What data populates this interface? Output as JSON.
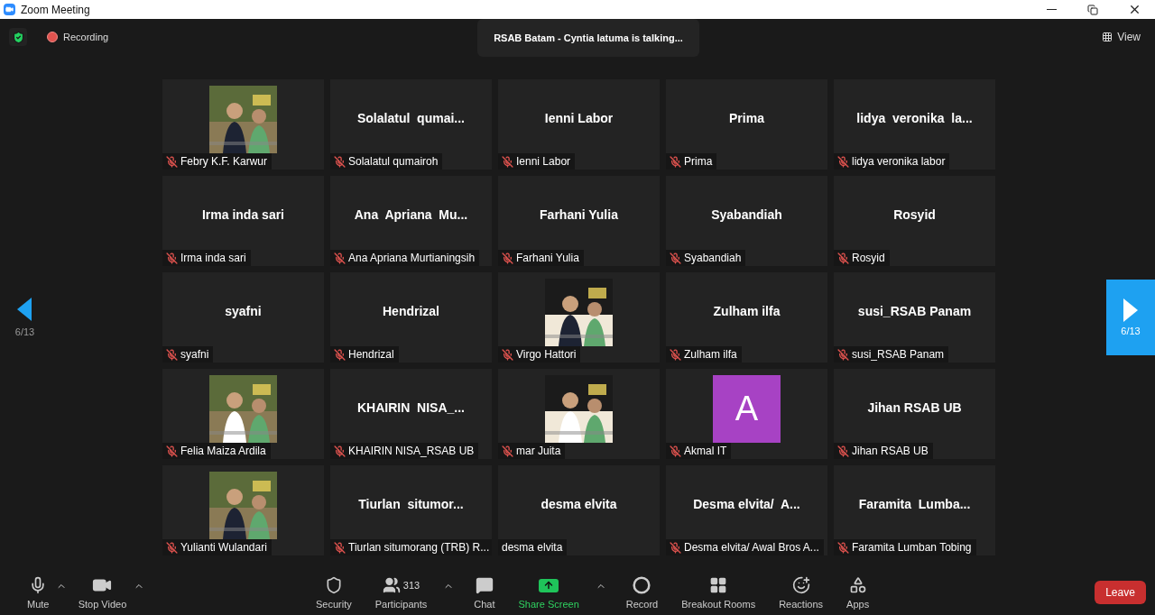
{
  "window": {
    "title": "Zoom Meeting"
  },
  "top_bar": {
    "recording": "Recording",
    "talking": "RSAB Batam - Cyntia latuma is talking...",
    "view": "View"
  },
  "pager": {
    "previous": "6/13",
    "next": "6/13"
  },
  "participants": [
    {
      "kind": "picture",
      "label": "Febry K.F. Karwur",
      "muted": true
    },
    {
      "kind": "name",
      "display_name": "Solalatul  qumai...",
      "label": "Solalatul qumairoh",
      "muted": true
    },
    {
      "kind": "name",
      "display_name": "Ienni Labor",
      "label": "Ienni Labor",
      "muted": true
    },
    {
      "kind": "name",
      "display_name": "Prima",
      "label": "Prima",
      "muted": true
    },
    {
      "kind": "name",
      "display_name": "lidya  veronika  la...",
      "label": "lidya veronika labor",
      "muted": true
    },
    {
      "kind": "name",
      "display_name": "Irma inda sari",
      "label": "Irma inda sari",
      "muted": true
    },
    {
      "kind": "name",
      "display_name": "Ana  Apriana  Mu...",
      "label": "Ana Apriana Murtianingsih",
      "muted": true
    },
    {
      "kind": "name",
      "display_name": "Farhani Yulia",
      "label": "Farhani Yulia",
      "muted": true
    },
    {
      "kind": "name",
      "display_name": "Syabandiah",
      "label": "Syabandiah",
      "muted": true
    },
    {
      "kind": "name",
      "display_name": "Rosyid",
      "label": "Rosyid",
      "muted": true
    },
    {
      "kind": "name",
      "display_name": "syafni",
      "label": "syafni",
      "muted": true
    },
    {
      "kind": "name",
      "display_name": "Hendrizal",
      "label": "Hendrizal",
      "muted": true
    },
    {
      "kind": "picture",
      "label": "Virgo Hattori",
      "muted": true
    },
    {
      "kind": "name",
      "display_name": "Zulham ilfa",
      "label": "Zulham ilfa",
      "muted": true
    },
    {
      "kind": "name",
      "display_name": "susi_RSAB Panam",
      "label": "susi_RSAB Panam",
      "muted": true
    },
    {
      "kind": "picture",
      "label": "Felia Maiza Ardila",
      "muted": true
    },
    {
      "kind": "name",
      "display_name": "KHAIRIN  NISA_...",
      "label": "KHAIRIN NISA_RSAB UB",
      "muted": true
    },
    {
      "kind": "picture",
      "label": "mar Juita",
      "muted": true
    },
    {
      "kind": "avatar",
      "letter": "A",
      "color": "#a742c4",
      "label": "Akmal IT",
      "muted": true
    },
    {
      "kind": "name",
      "display_name": "Jihan RSAB UB",
      "label": "Jihan RSAB UB",
      "muted": true
    },
    {
      "kind": "picture",
      "label": "Yulianti Wulandari",
      "muted": true
    },
    {
      "kind": "name",
      "display_name": "Tiurlan  situmor...",
      "label": "Tiurlan situmorang (TRB) R...",
      "muted": true
    },
    {
      "kind": "name",
      "display_name": "desma elvita",
      "label": "desma elvita",
      "muted": false
    },
    {
      "kind": "name",
      "display_name": "Desma elvita/  A...",
      "label": "Desma elvita/ Awal Bros A...",
      "muted": true
    },
    {
      "kind": "name",
      "display_name": "Faramita  Lumba...",
      "label": "Faramita Lumban Tobing",
      "muted": true
    }
  ],
  "toolbar": {
    "left": [
      {
        "label": "Mute",
        "has_menu": true
      },
      {
        "label": "Stop Video",
        "has_menu": true
      }
    ],
    "center": [
      {
        "label": "Security",
        "has_menu": false,
        "highlighted": false
      },
      {
        "label": "Participants",
        "count": "313",
        "has_menu": true,
        "highlighted": false
      },
      {
        "label": "Chat",
        "has_menu": false,
        "highlighted": false
      },
      {
        "label": "Share Screen",
        "has_menu": true,
        "highlighted": true
      },
      {
        "label": "Record",
        "has_menu": false,
        "highlighted": false
      },
      {
        "label": "Breakout Rooms",
        "has_menu": false,
        "highlighted": false
      },
      {
        "label": "Reactions",
        "has_menu": false,
        "highlighted": false
      },
      {
        "label": "Apps",
        "has_menu": false,
        "highlighted": false
      }
    ],
    "leave": "Leave"
  }
}
